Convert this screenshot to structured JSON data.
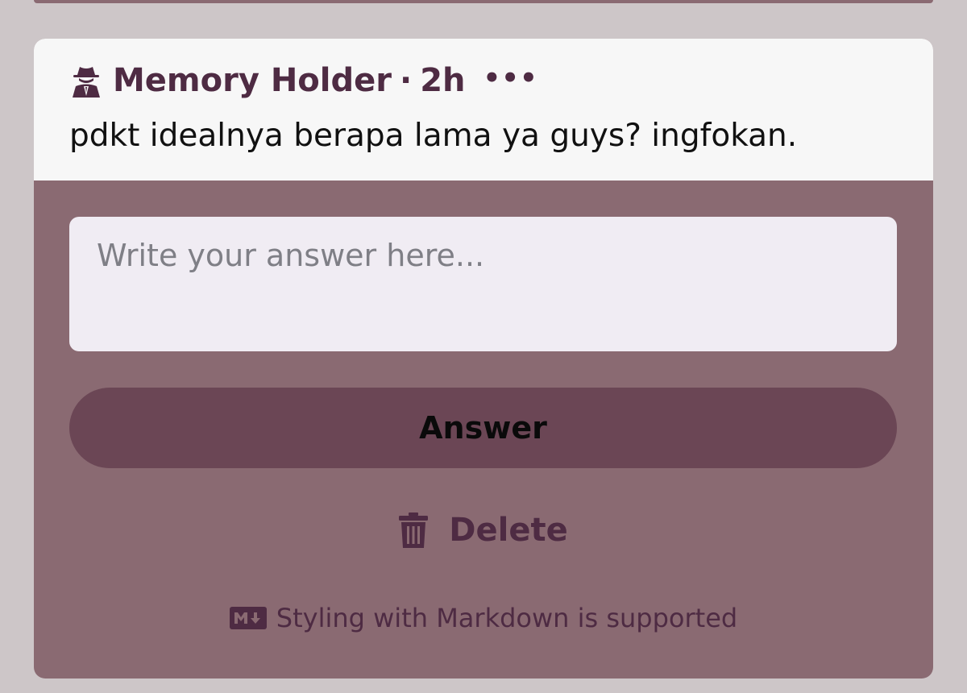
{
  "post": {
    "author": "Memory Holder",
    "separator": "·",
    "time": "2h",
    "more": "•••",
    "question": "pdkt idealnya berapa lama ya guys? ingfokan."
  },
  "answer_form": {
    "placeholder": "Write your answer here...",
    "value": "",
    "submit_label": "Answer",
    "delete_label": "Delete",
    "markdown_note": "Styling with Markdown is supported"
  },
  "icons": {
    "author_icon": "user-secret-icon",
    "more_icon": "ellipsis-icon",
    "delete_icon": "trash-icon",
    "markdown_icon": "markdown-icon"
  },
  "colors": {
    "page_background": "#cdc6c8",
    "header_background": "#f7f7f7",
    "card_background": "#8a6a72",
    "button_background": "#6b4655",
    "accent_text": "#4e2b43",
    "input_background": "#f0ecf3"
  }
}
